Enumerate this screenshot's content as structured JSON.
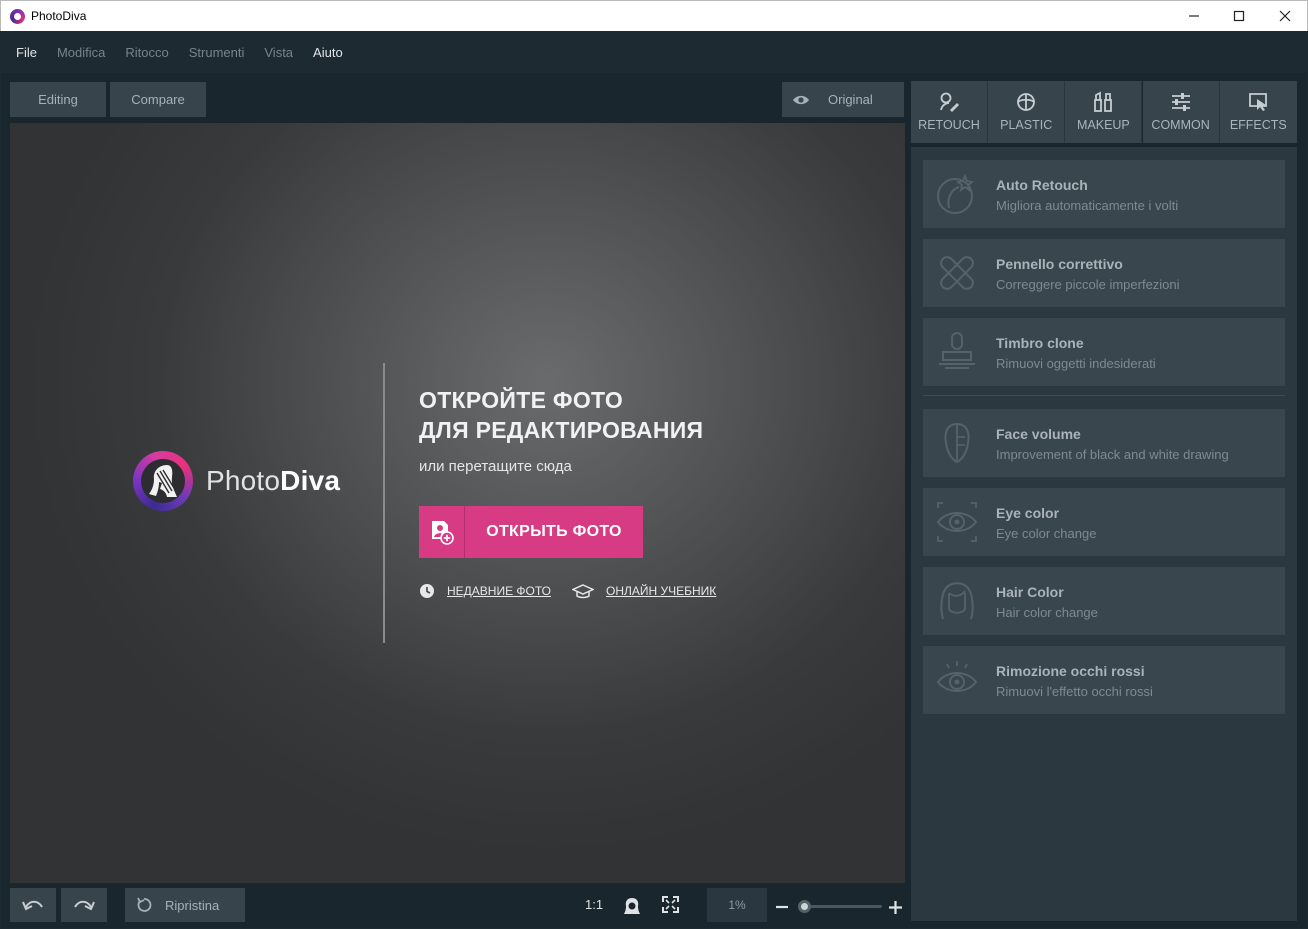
{
  "window": {
    "title": "PhotoDiva"
  },
  "menu": {
    "items": [
      "File",
      "Modifica",
      "Ritocco",
      "Strumenti",
      "Vista",
      "Aiuto"
    ]
  },
  "toolbar": {
    "editing_label": "Editing",
    "compare_label": "Compare",
    "original_label": "Original"
  },
  "canvas": {
    "logo_text_light": "Photo",
    "logo_text_bold": "Diva",
    "headline_line1": "ОТКРОЙТЕ ФОТО",
    "headline_line2": "ДЛЯ РЕДАКТИРОВАНИЯ",
    "subline": "или перетащите сюда",
    "open_button": "ОТКРЫТЬ ФОТО",
    "recent_link": "НЕДАВНИЕ ФОТО",
    "tutorial_link": "ОНЛАЙН УЧЕБНИК"
  },
  "tabs": [
    {
      "label": "RETOUCH",
      "icon": "retouch-icon"
    },
    {
      "label": "PLASTIC",
      "icon": "plastic-icon"
    },
    {
      "label": "MAKEUP",
      "icon": "makeup-icon"
    },
    {
      "label": "COMMON",
      "icon": "sliders-icon"
    },
    {
      "label": "EFFECTS",
      "icon": "effects-icon"
    }
  ],
  "tools": [
    {
      "title": "Auto Retouch",
      "subtitle": "Migliora automaticamente i volti",
      "icon": "auto-retouch-icon"
    },
    {
      "title": "Pennello correttivo",
      "subtitle": "Correggere piccole imperfezioni",
      "icon": "bandage-icon"
    },
    {
      "title": "Timbro clone",
      "subtitle": "Rimuovi oggetti indesiderati",
      "icon": "stamp-icon"
    },
    {
      "title": "Face volume",
      "subtitle": "Improvement of black and white drawing",
      "icon": "face-volume-icon"
    },
    {
      "title": "Eye color",
      "subtitle": "Eye color change",
      "icon": "eye-color-icon"
    },
    {
      "title": "Hair Color",
      "subtitle": "Hair color change",
      "icon": "hair-icon"
    },
    {
      "title": "Rimozione occhi rossi",
      "subtitle": "Rimuovi l'effetto occhi rossi",
      "icon": "red-eye-icon"
    }
  ],
  "bottom": {
    "reset_label": "Ripristina",
    "ratio_label": "1:1",
    "zoom_value": "1%",
    "zoom_slider_fraction": 0.05
  },
  "colors": {
    "accent": "#d63b83",
    "background": "#1e2a32",
    "panel": "#2b3840",
    "button": "#38444b"
  }
}
